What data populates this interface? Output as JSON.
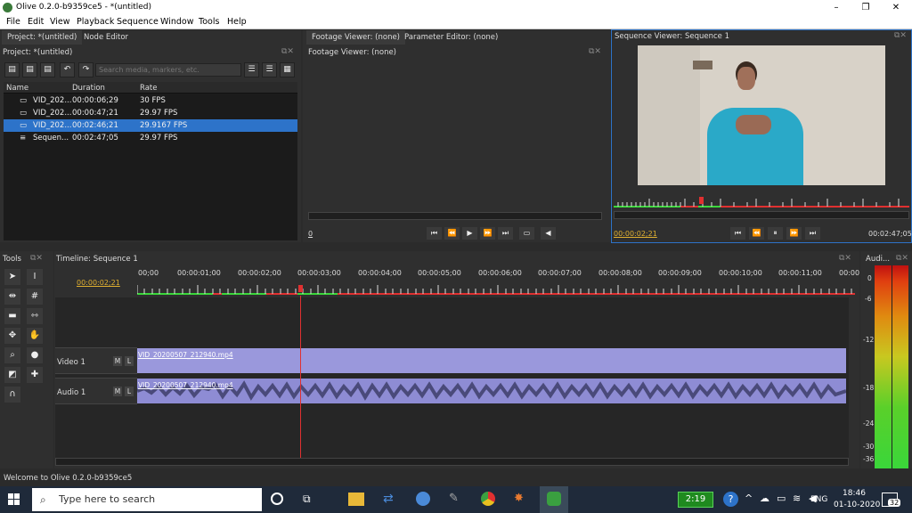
{
  "window": {
    "title": "Olive 0.2.0-b9359ce5 - *(untitled)",
    "min": "–",
    "max": "❐",
    "close": "✕"
  },
  "menu": [
    "File",
    "Edit",
    "View",
    "Playback",
    "Sequence",
    "Window",
    "Tools",
    "Help"
  ],
  "project_panel": {
    "tabs": [
      "Project: *(untitled)",
      "Node Editor"
    ],
    "title": "Project: *(untitled)",
    "search_placeholder": "Search media, markers, etc.",
    "columns": [
      "Name",
      "Duration",
      "Rate"
    ],
    "rows": [
      {
        "name": "VID_202...",
        "duration": "00:00:06;29",
        "rate": "30 FPS",
        "icon": "camera-icon"
      },
      {
        "name": "VID_202...",
        "duration": "00:00:47;21",
        "rate": "29.97 FPS",
        "icon": "camera-icon"
      },
      {
        "name": "VID_202...",
        "duration": "00:02:46;21",
        "rate": "29.9167 FPS",
        "icon": "camera-icon"
      },
      {
        "name": "Sequen...",
        "duration": "00:02:47;05",
        "rate": "29.97 FPS",
        "icon": "sequence-icon"
      }
    ]
  },
  "footage_viewer": {
    "tabs": [
      "Footage Viewer: (none)",
      "Parameter Editor: (none)"
    ],
    "title": "Footage Viewer: (none)",
    "timecode": "0"
  },
  "sequence_viewer": {
    "title": "Sequence Viewer: Sequence 1",
    "current_time": "00:00:02;21",
    "end_time": "00:02:47;05"
  },
  "tools_panel": {
    "title": "Tools"
  },
  "timeline": {
    "title": "Timeline: Sequence 1",
    "current_time": "00:00:02;21",
    "ruler": [
      "00;00",
      "00:00:01;00",
      "00:00:02;00",
      "00:00:03;00",
      "00:00:04;00",
      "00:00:05;00",
      "00:00:06;00",
      "00:00:07;00",
      "00:00:08;00",
      "00:00:09;00",
      "00:00:10;00",
      "00:00:11;00",
      "00:00"
    ],
    "tracks": [
      {
        "name": "Video 1",
        "clip": "VID_20200507_212940.mp4"
      },
      {
        "name": "Audio 1",
        "clip": "VID_20200507_212940.mp4"
      }
    ],
    "mute": "M",
    "lock": "L"
  },
  "audio_panel": {
    "title": "Audi...",
    "scale": [
      "0",
      "-6",
      "-12",
      "-18",
      "-24",
      "-30",
      "-36"
    ]
  },
  "status": "Welcome to Olive 0.2.0-b9359ce5",
  "taskbar": {
    "search_placeholder": "Type here to search",
    "battery": "2:19",
    "lang": "ENG",
    "time": "18:46",
    "date": "01-10-2020",
    "notifications": "32"
  },
  "colors": {
    "accent": "#2d73c9",
    "clip_video": "#9a98dc",
    "clip_audio": "#8e8cd4",
    "playhead": "#e03030",
    "timecode": "#e0b030"
  }
}
